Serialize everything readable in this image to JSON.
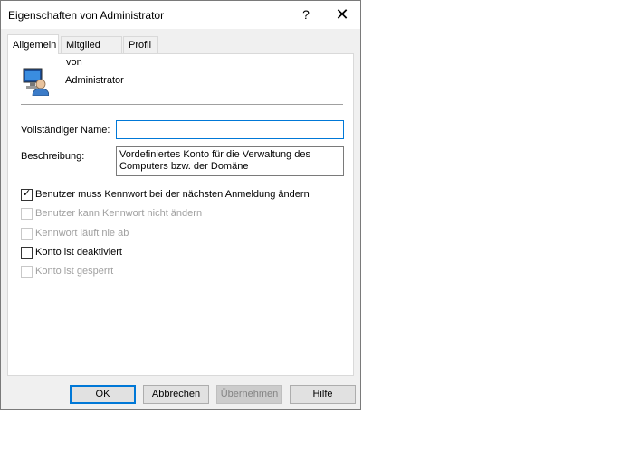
{
  "window": {
    "title": "Eigenschaften von Administrator",
    "help_glyph": "?",
    "close_glyph": "✕"
  },
  "tabs": [
    {
      "label": "Allgemein",
      "active": true
    },
    {
      "label": "Mitglied von",
      "active": false
    },
    {
      "label": "Profil",
      "active": false
    }
  ],
  "account": {
    "name": "Administrator",
    "icon": "user-account-icon"
  },
  "form": {
    "full_name_label": "Vollständiger Name:",
    "full_name_value": "",
    "description_label": "Beschreibung:",
    "description_value": "Vordefiniertes Konto für die Verwaltung des Computers bzw. der Domäne"
  },
  "checkboxes": [
    {
      "label": "Benutzer muss Kennwort bei der nächsten Anmeldung ändern",
      "checked": true,
      "enabled": true
    },
    {
      "label": "Benutzer kann Kennwort nicht ändern",
      "checked": false,
      "enabled": false
    },
    {
      "label": "Kennwort läuft nie ab",
      "checked": false,
      "enabled": false
    },
    {
      "label": "Konto ist deaktiviert",
      "checked": false,
      "enabled": true
    },
    {
      "label": "Konto ist gesperrt",
      "checked": false,
      "enabled": false
    }
  ],
  "buttons": {
    "ok": "OK",
    "cancel": "Abbrechen",
    "apply": "Übernehmen",
    "help": "Hilfe"
  }
}
